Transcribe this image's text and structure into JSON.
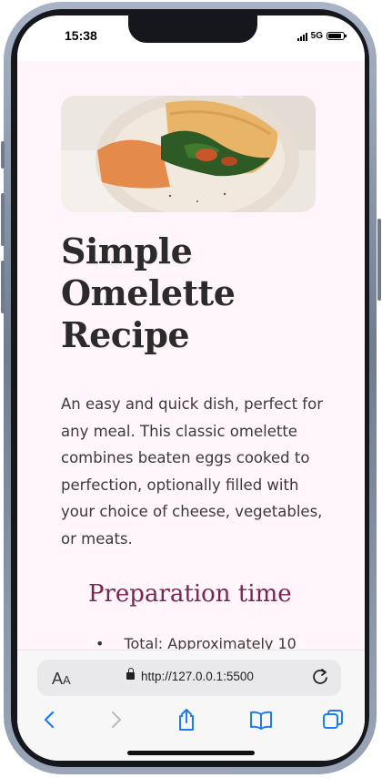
{
  "status_bar": {
    "time": "15:38",
    "network": "5G",
    "battery_level": 0.85
  },
  "page": {
    "hero_image": "omelette-photo",
    "title": "Simple Omelette Recipe",
    "description": "An easy and quick dish, perfect for any meal. This classic omelette combines beaten eggs cooked to perfection, optionally filled with your choice of cheese, vegetables, or meats.",
    "section_title": "Preparation time",
    "list_items": [
      "Total: Approximately 10"
    ],
    "bullet": "•"
  },
  "browser": {
    "aa_large": "A",
    "aa_small": "A",
    "url": "http://127.0.0.1:5500",
    "icons": [
      "lock-icon",
      "reload-icon",
      "back-icon",
      "forward-icon",
      "share-icon",
      "bookmarks-icon",
      "tabs-icon"
    ]
  },
  "colors": {
    "page_bg": "#fff5fb",
    "title": "#2b2b2b",
    "accent": "#7a2450",
    "browser_icons": "#1e7cf2",
    "disabled_icon": "#b9bec6"
  }
}
